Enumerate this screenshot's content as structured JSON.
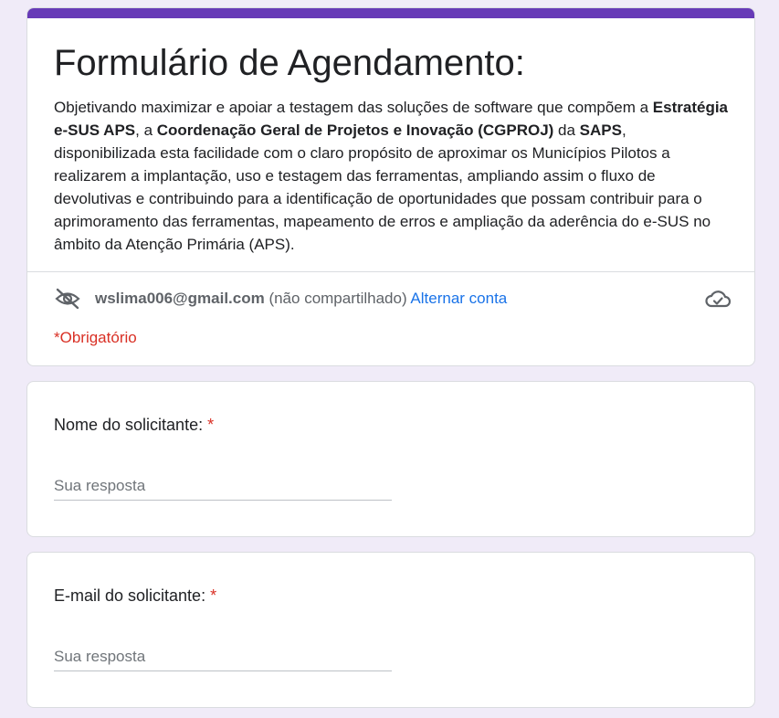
{
  "form": {
    "title": "Formulário de Agendamento:",
    "description": {
      "part1": "Objetivando maximizar e apoiar a testagem das soluções de software que compõem a ",
      "bold1": "Estratégia e-SUS APS",
      "part2": ", a ",
      "bold2": "Coordenação Geral de Projetos e Inovação (CGPROJ)",
      "part3": " da ",
      "bold3": "SAPS",
      "part4": ", disponibilizada esta facilidade com o claro propósito de aproximar os Municípios Pilotos a realizarem a implantação, uso e testagem das ferramentas, ampliando assim o fluxo de devolutivas e contribuindo para a identificação de oportunidades que possam contribuir para o aprimoramento das ferramentas, mapeamento de erros e ampliação da aderência do e-SUS no âmbito da Atenção Primária (APS)."
    },
    "accent_color": "#673ab7"
  },
  "account": {
    "email": "wslima006@gmail.com",
    "share_status": " (não compartilhado) ",
    "switch_label": "Alternar conta",
    "hidden_icon": "eye-off-icon",
    "cloud_icon": "cloud-check-icon"
  },
  "required_note": "*Obrigatório",
  "questions": [
    {
      "label": "Nome do solicitante: ",
      "required_mark": "*",
      "placeholder": "Sua resposta"
    },
    {
      "label": "E-mail do solicitante: ",
      "required_mark": "*",
      "placeholder": "Sua resposta"
    }
  ]
}
